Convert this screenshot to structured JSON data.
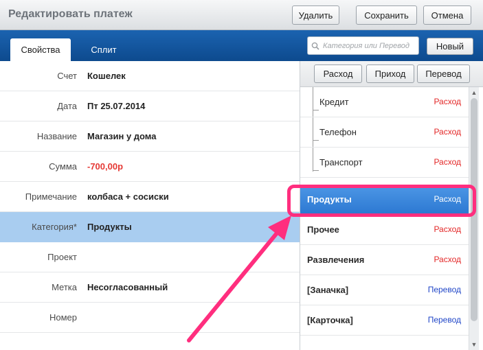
{
  "window": {
    "title": "Редактировать платеж",
    "buttons": {
      "delete": "Удалить",
      "save": "Сохранить",
      "cancel": "Отмена"
    }
  },
  "tabs": [
    {
      "label": "Свойства",
      "active": true
    },
    {
      "label": "Сплит",
      "active": false
    }
  ],
  "search": {
    "placeholder": "Категория или Перевод",
    "value": "",
    "icon": "search-icon"
  },
  "new_button": "Новый",
  "form": {
    "rows": [
      {
        "label": "Счет",
        "value": "Кошелек"
      },
      {
        "label": "Дата",
        "value": "Пт 25.07.2014"
      },
      {
        "label": "Название",
        "value": "Магазин у дома"
      },
      {
        "label": "Сумма",
        "value": "-700,00р"
      },
      {
        "label": "Примечание",
        "value": "колбаса + сосиски"
      },
      {
        "label": "Категория*",
        "value": "Продукты"
      },
      {
        "label": "Проект",
        "value": ""
      },
      {
        "label": "Метка",
        "value": "Несогласованный"
      },
      {
        "label": "Номер",
        "value": ""
      }
    ]
  },
  "type_buttons": {
    "expense": "Расход",
    "income": "Приход",
    "transfer": "Перевод"
  },
  "categories": [
    {
      "name": "Кредит",
      "type": "Расход",
      "level": "child"
    },
    {
      "name": "Телефон",
      "type": "Расход",
      "level": "child"
    },
    {
      "name": "Транспорт",
      "type": "Расход",
      "level": "child"
    },
    {
      "name": "Продукты",
      "type": "Расход",
      "level": "root",
      "selected": true
    },
    {
      "name": "Прочее",
      "type": "Расход",
      "level": "root"
    },
    {
      "name": "Развлечения",
      "type": "Расход",
      "level": "root"
    },
    {
      "name": "[Заначка]",
      "type": "Перевод",
      "level": "root"
    },
    {
      "name": "[Карточка]",
      "type": "Перевод",
      "level": "root"
    }
  ],
  "colors": {
    "accent": "#1b63b0",
    "expense": "#e32626",
    "transfer": "#1f45c7",
    "negative_amount": "#e53935",
    "selected_row": "#a9cdf0",
    "selected_item": "#2c78d2",
    "annotation": "#ff2e7e"
  }
}
